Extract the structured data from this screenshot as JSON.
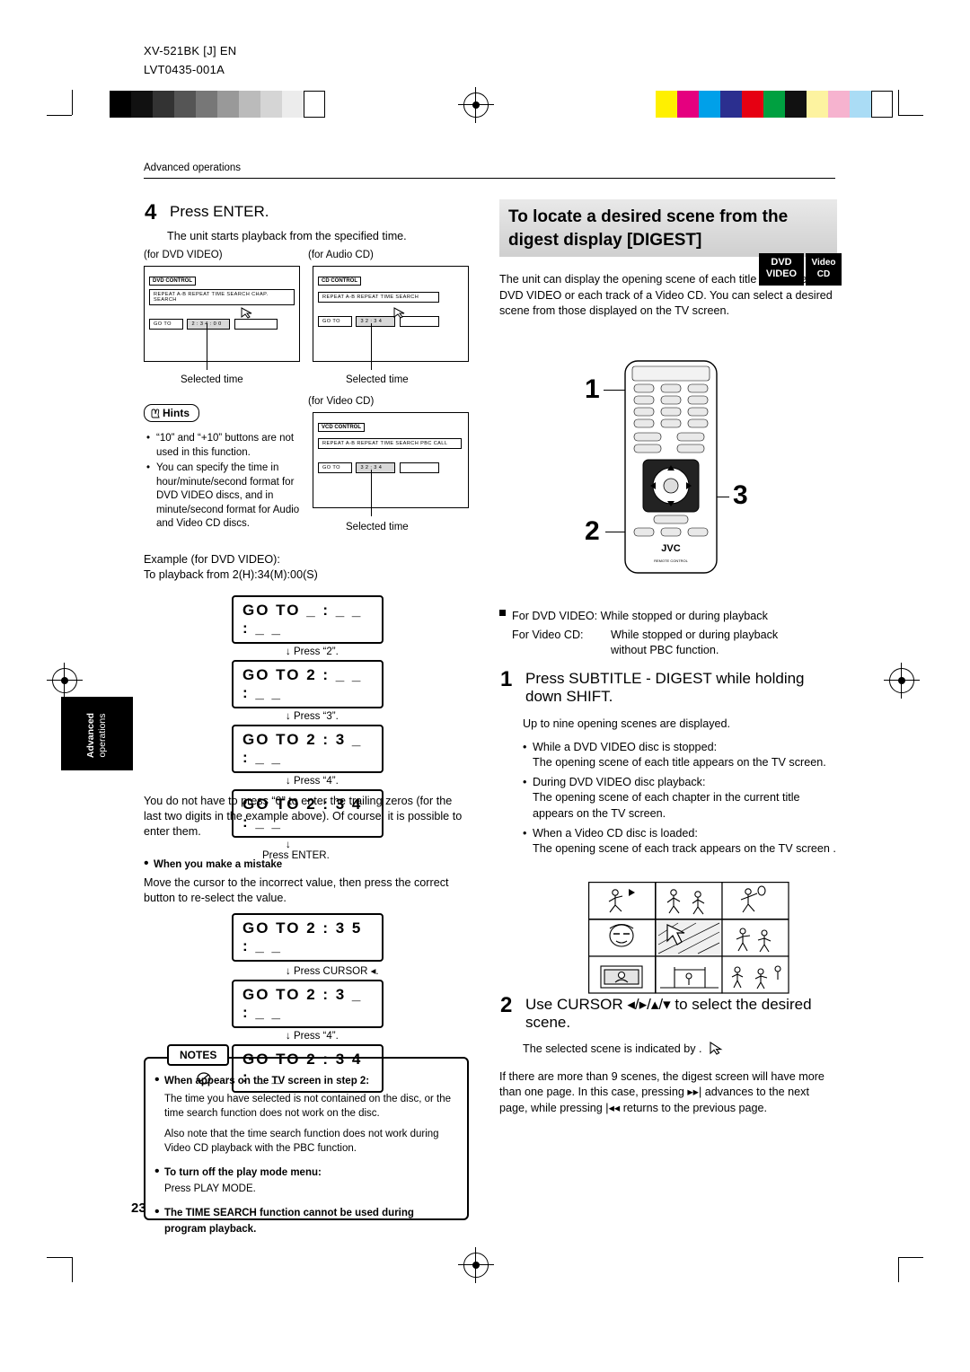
{
  "header": {
    "model": "XV-521BK [J] EN",
    "doc_no": "LVT0435-001A"
  },
  "section_label": "Advanced operations",
  "page_number": "23",
  "side_tab": {
    "line1": "Advanced",
    "line2": "operations"
  },
  "left": {
    "step4": {
      "num": "4",
      "title": "Press ENTER.",
      "desc": "The unit starts playback from the specified time."
    },
    "osd_captions": {
      "dvd": "(for DVD VIDEO)",
      "audio": "(for Audio CD)",
      "video": "(for Video CD)"
    },
    "osd_dvd": {
      "title": "DVD CONTROL",
      "row": "REPEAT   A-B REPEAT   TIME SEARCH   CHAP. SEARCH",
      "goto": "GO TO",
      "time": "2 : 3 4 : 0 0",
      "caption": "Selected time"
    },
    "osd_cd": {
      "title": "CD CONTROL",
      "row": "REPEAT   A-B REPEAT   TIME SEARCH",
      "goto": "GO TO",
      "time": "3 2 : 3 4",
      "caption": "Selected time"
    },
    "osd_vcd": {
      "title": "VCD CONTROL",
      "row": "REPEAT   A-B REPEAT   TIME SEARCH   PBC CALL",
      "goto": "GO TO",
      "time": "3 2 : 3 4",
      "caption": "Selected time"
    },
    "hints": {
      "label": "Hints",
      "items": [
        "“10” and “+10” buttons are not used in this function.",
        "You can specify the time in hour/minute/second format for DVD VIDEO discs, and in minute/second format for Audio and Video CD discs."
      ]
    },
    "example": {
      "line1": "Example (for DVD VIDEO):",
      "line2": "To playback from 2(H):34(M):00(S)"
    },
    "sequence": [
      {
        "box": "GO TO  _ :  _ _ :  _ _",
        "arrow": "↓  Press “2”."
      },
      {
        "box": "GO TO  2 :  _ _ :  _ _",
        "arrow": "↓  Press “3”."
      },
      {
        "box": "GO TO  2 :  3 _ :  _ _",
        "arrow": "↓  Press “4”."
      },
      {
        "box": "GO TO  2 :  3 4 :  _ _",
        "arrow": "↓"
      }
    ],
    "press_enter": "Press ENTER.",
    "trailing_zeros": "You do not have to press “0” to enter the trailing zeros (for the last two digits in the example above). Of course, it is possible to enter them.",
    "mistake": {
      "title": "When you make a mistake",
      "desc": "Move the cursor to the incorrect value, then press the correct button to re-select the value."
    },
    "sequence2": [
      {
        "box": "GO TO  2 :  3 5 :  _ _",
        "arrow": "↓  Press CURSOR ◂."
      },
      {
        "box": "GO TO  2 :  3 _ :  _ _",
        "arrow": "↓  Press “4”."
      },
      {
        "box": "GO TO  2 :  3 4 :  _ _",
        "arrow": ""
      }
    ],
    "notes": {
      "header": "NOTES",
      "item1_title": "When        appears on the TV screen in step 2:",
      "item1_body1": "The time you have selected is not contained on the disc, or the time search function does not work on the disc.",
      "item1_body2": "Also note that the time search function does not work during Video CD playback with the PBC function.",
      "item2_title": "To turn off the play mode menu:",
      "item2_body": "Press PLAY MODE.",
      "item3_title": "The TIME SEARCH function cannot be used during program playback."
    }
  },
  "right": {
    "banner": "To locate a desired scene from the digest display [DIGEST]",
    "logo_dvd": {
      "line1": "DVD",
      "line2": "VIDEO"
    },
    "logo_vcd": {
      "line1": "Video",
      "line2": "CD"
    },
    "intro": "The unit can display the opening scene of each title or chapter on a DVD VIDEO or each track of a Video CD. You can select a desired scene from those displayed on the TV screen.",
    "callouts": {
      "one": "1",
      "two": "2",
      "three": "3"
    },
    "avail": {
      "bullet_title": "For DVD VIDEO:",
      "bullet_text": "While stopped or during playback",
      "line2_label": "For Video CD:",
      "line2_text1": "While stopped or during playback",
      "line2_text2": "without PBC function."
    },
    "step1": {
      "num": "1",
      "title": "Press SUBTITLE - DIGEST while holding down SHIFT.",
      "desc": "Up to nine opening scenes are displayed.",
      "items": [
        {
          "head": "While a DVD VIDEO disc is stopped:",
          "body": "The opening scene of each title appears on the TV screen."
        },
        {
          "head": "During DVD VIDEO disc playback:",
          "body": "The opening scene of each chapter in the current title appears on the TV screen."
        },
        {
          "head": "When a Video CD disc is loaded:",
          "body": "The opening scene of each track appears on the TV screen ."
        }
      ]
    },
    "step2": {
      "num": "2",
      "title": "Use CURSOR ◂/▸/▴/▾ to select the desired scene.",
      "desc1": "The selected scene is indicated by       .",
      "desc2": "If there are more than 9 scenes, the digest screen will have more than one page. In this case, pressing ▸▸| advances to the next page, while pressing |◂◂ returns to the previous page."
    }
  },
  "remote": {
    "brand": "JVC",
    "caption": "REMOTE CONTROL"
  },
  "colors": {
    "banner_gray": "#dcdcdc",
    "black": "#000000",
    "white": "#ffffff"
  }
}
